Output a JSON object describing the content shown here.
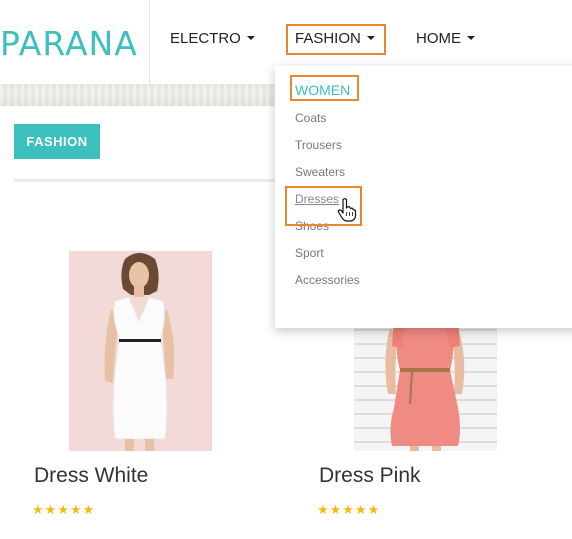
{
  "header": {
    "logo": "PARANA",
    "nav": [
      {
        "label": "ELECTRO"
      },
      {
        "label": "FASHION"
      },
      {
        "label": "HOME"
      }
    ]
  },
  "section": {
    "badge": "FASHION"
  },
  "dropdown": {
    "heading": "WOMEN",
    "items": [
      "Coats",
      "Trousers",
      "Sweaters",
      "Dresses",
      "Shoes",
      "Sport",
      "Accessories"
    ]
  },
  "products": [
    {
      "name": "Dress White",
      "stars": "★★★★★"
    },
    {
      "name": "Dress Pink",
      "stars": "★★★★★"
    }
  ],
  "colors": {
    "accent": "#3bbfbf",
    "highlight": "#e8882e",
    "star": "#f6b90d"
  }
}
